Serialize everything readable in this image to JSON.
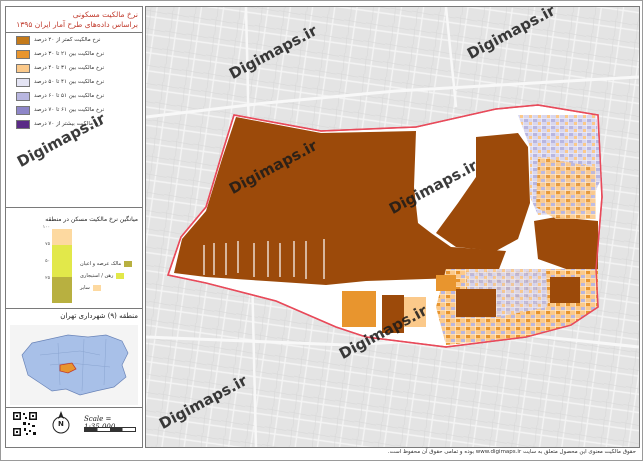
{
  "legend": {
    "title": "نرخ مالکیت مسکونی",
    "subtitle": "براساس داده‌های طرح آمار ایران ۱۳۹۵",
    "items": [
      {
        "label": "نرخ مالکیت کمتر از ۲۰ درصد",
        "color": "#c47a1a"
      },
      {
        "label": "نرخ مالکیت بین ۲۱ تا ۳۰ درصد",
        "color": "#e8952e"
      },
      {
        "label": "نرخ مالکیت بین ۳۱ تا ۴۰ درصد",
        "color": "#fbc98a"
      },
      {
        "label": "نرخ مالکیت بین ۴۱ تا ۵۰ درصد",
        "color": "#e4e4f4"
      },
      {
        "label": "نرخ مالکیت بین ۵۱ تا ۶۰ درصد",
        "color": "#b8b6e0"
      },
      {
        "label": "نرخ مالکیت بین ۶۱ تا ۷۰ درصد",
        "color": "#8e86c8"
      },
      {
        "label": "نرخ مالکیت بیشتر از ۷۰ درصد",
        "color": "#5a2a86"
      }
    ]
  },
  "chart": {
    "title": "میانگین نرخ مالکیت مسکن در منطقه",
    "ticks": [
      "۱۰۰",
      "۷۵",
      "۵۰",
      "۲۵"
    ],
    "segments": [
      {
        "label": "مالک عرصه و اعیان",
        "color": "#b8b040"
      },
      {
        "label": "رهن / استیجاری",
        "color": "#e2e84a"
      },
      {
        "label": "سایر",
        "color": "#fdd9a0"
      }
    ]
  },
  "location": {
    "title": "منطقه (۹) شهرداری تهران"
  },
  "scale": "Scale = 1:35,000",
  "north": "N",
  "footer": "حقوق مالکیت معنوی این محصول متعلق به سایت www.digimaps.ir بوده و تمامی حقوق آن محفوظ است.",
  "watermark": "Digimaps.ir",
  "colors": {
    "dark_brown": "#9c4a0a",
    "orange": "#e8952e",
    "light_orange": "#fbc98a",
    "lavender": "#b8b6e0",
    "boundary": "#e84a5a"
  }
}
